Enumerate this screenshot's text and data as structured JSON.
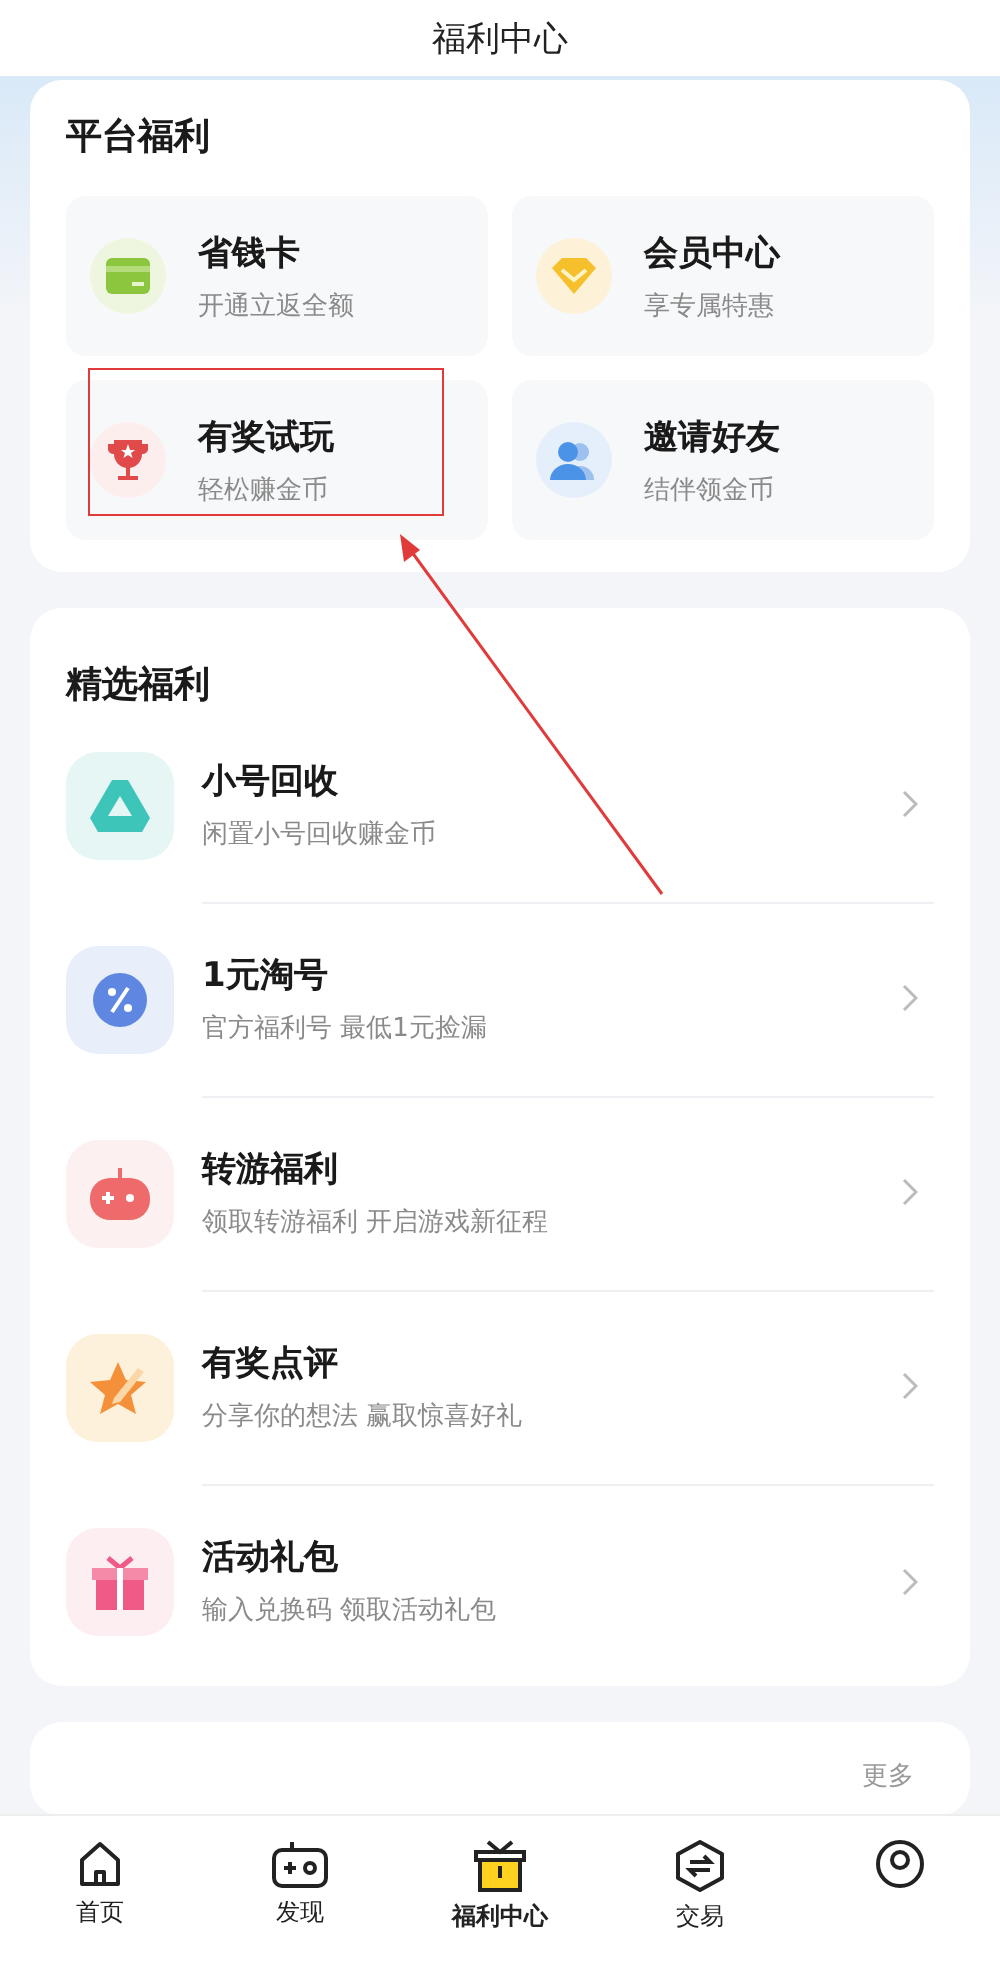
{
  "window": {
    "title": "福利中心"
  },
  "platform": {
    "title": "平台福利",
    "items": [
      {
        "kind": "card",
        "title": "省钱卡",
        "subtitle": "开通立返全额"
      },
      {
        "kind": "crown",
        "title": "会员中心",
        "subtitle": "享专属特惠"
      },
      {
        "kind": "trophy",
        "title": "有奖试玩",
        "subtitle": "轻松赚金币"
      },
      {
        "kind": "people",
        "title": "邀请好友",
        "subtitle": "结伴领金币"
      }
    ]
  },
  "featured": {
    "title": "精选福利",
    "items": [
      {
        "kind": "recycle",
        "title": "小号回收",
        "subtitle": "闲置小号回收赚金币"
      },
      {
        "kind": "discount",
        "title": "1元淘号",
        "subtitle": "官方福利号 最低1元捡漏"
      },
      {
        "kind": "gamepad",
        "title": "转游福利",
        "subtitle": "领取转游福利 开启游戏新征程"
      },
      {
        "kind": "review",
        "title": "有奖点评",
        "subtitle": "分享你的想法 赢取惊喜好礼"
      },
      {
        "kind": "gift",
        "title": "活动礼包",
        "subtitle": "输入兑换码 领取活动礼包"
      }
    ]
  },
  "next_section": {
    "more": "更多"
  },
  "tab_bar": [
    {
      "kind": "home",
      "label": "首页",
      "selected": false
    },
    {
      "kind": "discover",
      "label": "发现",
      "selected": false
    },
    {
      "kind": "welfare",
      "label": "福利中心",
      "selected": true
    },
    {
      "kind": "trade",
      "label": "交易",
      "selected": false
    },
    {
      "kind": "profile",
      "selected": false
    }
  ]
}
